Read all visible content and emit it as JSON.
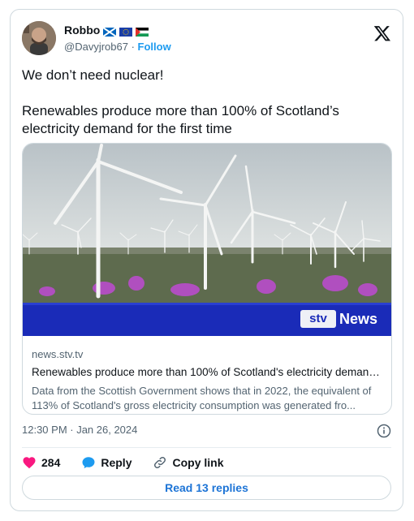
{
  "author": {
    "display_name": "Robbo",
    "handle": "@Davyjrob67",
    "separator": "·",
    "follow_label": "Follow"
  },
  "tweet": {
    "line1": "We don’t need nuclear!",
    "line2": "Renewables produce more than 100% of Scotland’s electricity demand for the first time"
  },
  "link_card": {
    "logo_text": "News",
    "domain": "news.stv.tv",
    "title": "Renewables produce more than 100% of Scotland's electricity demand...",
    "description": "Data from the Scottish Government shows that in 2022, the equivalent of 113% of Scotland's gross electricity consumption was generated fro..."
  },
  "meta": {
    "timestamp": "12:30 PM · Jan 26, 2024"
  },
  "actions": {
    "like_count": "284",
    "reply_label": "Reply",
    "copy_link_label": "Copy link",
    "read_replies_label": "Read 13 replies"
  },
  "colors": {
    "accent": "#1d9bf0",
    "like": "#f91880",
    "stv_band": "#1a2bb8"
  }
}
